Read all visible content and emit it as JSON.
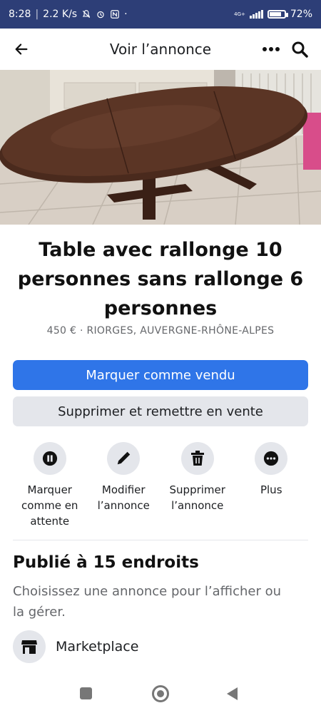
{
  "status_bar": {
    "time": "8:28",
    "speed": "2.2 K/s",
    "network": "4G+",
    "battery": "72%",
    "battery_level": 0.72
  },
  "app_bar": {
    "title": "Voir l’annonce"
  },
  "listing": {
    "title": "Table avec rallonge 10 personnes sans rallonge 6 personnes",
    "meta": "450 € · RIORGES, AUVERGNE-RHÔNE-ALPES"
  },
  "buttons": {
    "mark_sold": "Marquer comme vendu",
    "delete_relist": "Supprimer et remettre en vente"
  },
  "actions": [
    {
      "label": "Marquer\ncomme en\nattente",
      "icon": "pause-icon"
    },
    {
      "label": "Modifier\nl’annonce",
      "icon": "pencil-icon"
    },
    {
      "label": "Supprimer\nl’annonce",
      "icon": "trash-icon"
    },
    {
      "label": "Plus",
      "icon": "more-icon"
    }
  ],
  "published": {
    "title": "Publié à 15 endroits",
    "subtitle": "Choisissez une annonce pour l’afficher ou la gérer.",
    "marketplace_label": "Marketplace"
  },
  "colors": {
    "status_bar": "#2d3e77",
    "primary": "#2f75e8",
    "secondary": "#e4e6eb"
  }
}
